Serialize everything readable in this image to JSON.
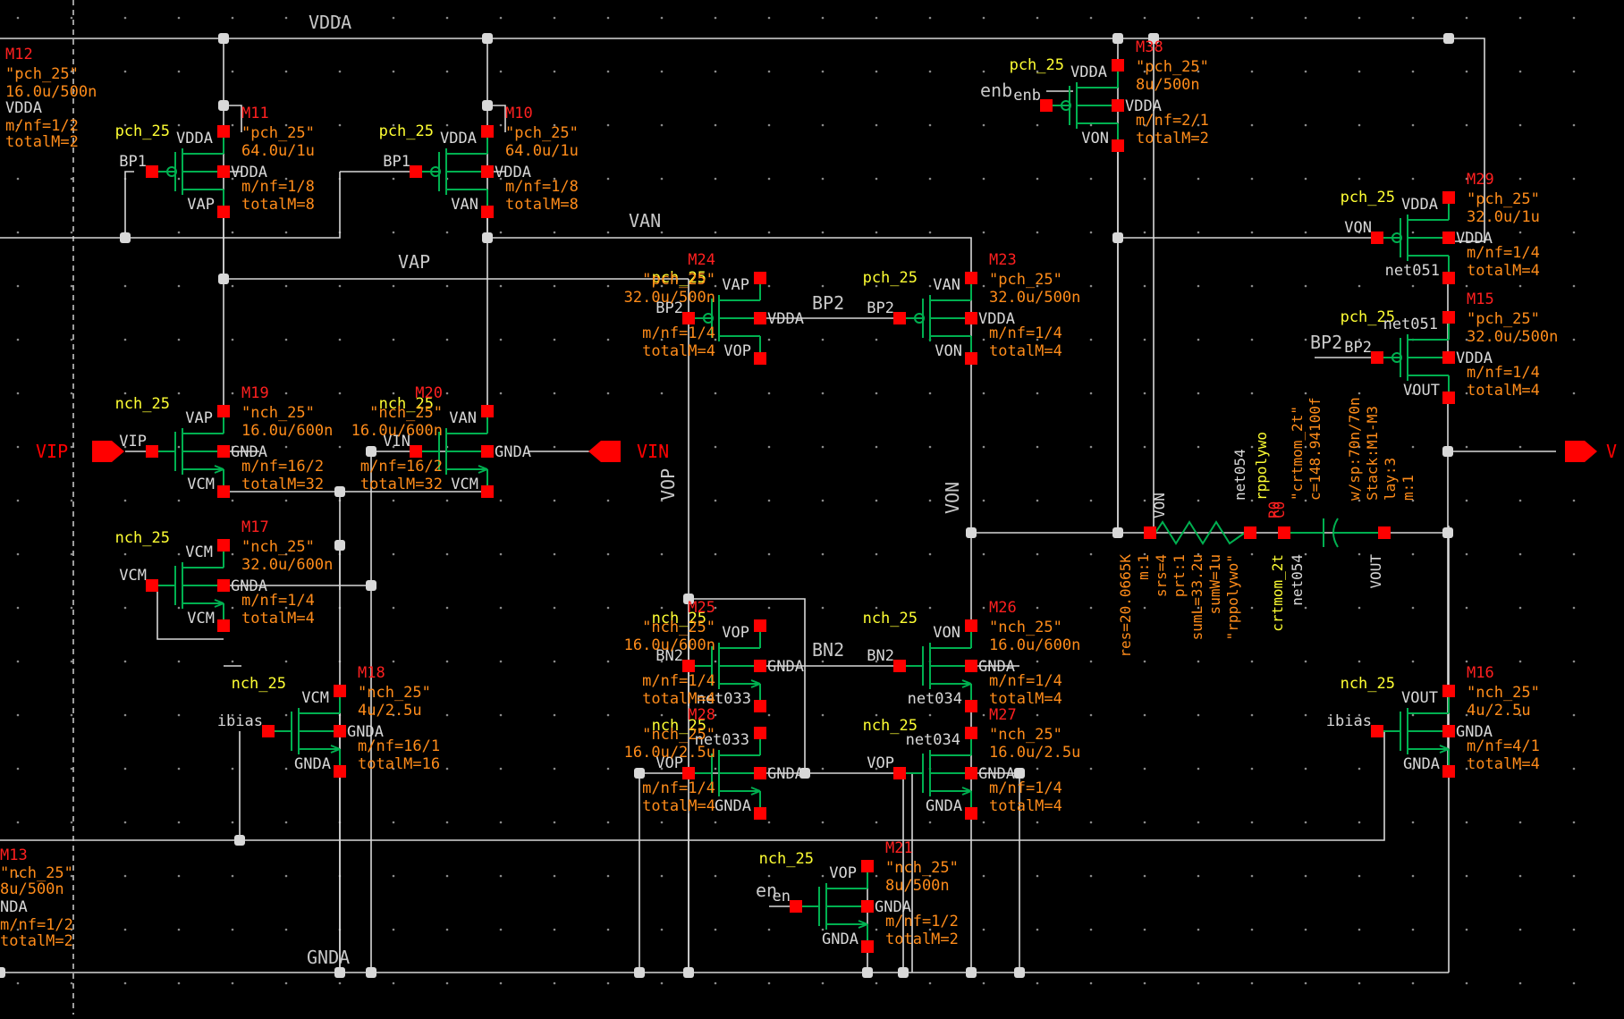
{
  "colors": {
    "background": "#000000",
    "wire": "#d8d8d8",
    "net_label": "#c8c8c8",
    "instance_name": "#ff2020",
    "cell_name": "#ffff33",
    "property": "#ff8c1a",
    "pin": "#ff0000",
    "symbol": "#00b050",
    "grid_dot": "#8a8a8a",
    "io_pin": "#ff0000"
  },
  "rails": {
    "vdd": "VDDA",
    "gnd": "GNDA"
  },
  "nets": {
    "van": "VAN",
    "vap": "VAP",
    "bp2": "BP2",
    "bn2": "BN2",
    "vop": "VOP",
    "von": "VON",
    "enb": "enb",
    "en": "en",
    "bp2_in": "BP2"
  },
  "ports": {
    "vip": "VIP",
    "vin": "VIN",
    "vout": "V"
  },
  "transistors": [
    {
      "inst": "M12",
      "cell": "",
      "model": "\"pch_25\"",
      "size": "16.0u/500n",
      "pin_b": "VDDA",
      "mnf": "m/nf=1/2",
      "total": "totalM=2"
    },
    {
      "inst": "M11",
      "cell": "pch_25",
      "model": "\"pch_25\"",
      "size": "64.0u/1u",
      "pin_g": "BP1",
      "pin_s": "VDDA",
      "pin_b": "VDDA",
      "pin_d": "VAP",
      "mnf": "m/nf=1/8",
      "total": "totalM=8"
    },
    {
      "inst": "M10",
      "cell": "pch_25",
      "model": "\"pch_25\"",
      "size": "64.0u/1u",
      "pin_g": "BP1",
      "pin_s": "VDDA",
      "pin_b": "VDDA",
      "pin_d": "VAN",
      "mnf": "m/nf=1/8",
      "total": "totalM=8"
    },
    {
      "inst": "M38",
      "cell": "pch_25",
      "model": "\"pch_25\"",
      "size": "8u/500n",
      "pin_g": "enb",
      "pin_s": "VDDA",
      "pin_b": "VDDA",
      "pin_d": "VON",
      "mnf": "m/nf=2/1",
      "total": "totalM=2"
    },
    {
      "inst": "M29",
      "cell": "pch_25",
      "model": "\"pch_25\"",
      "size": "32.0u/1u",
      "pin_g": "VON",
      "pin_s": "VDDA",
      "pin_b": "VDDA",
      "pin_d": "net051",
      "mnf": "m/nf=1/4",
      "total": "totalM=4"
    },
    {
      "inst": "M15",
      "cell": "pch_25",
      "model": "\"pch_25\"",
      "size": "32.0u/500n",
      "pin_g": "BP2",
      "pin_s": "net051",
      "pin_b": "VDDA",
      "pin_d": "VOUT",
      "mnf": "m/nf=1/4",
      "total": "totalM=4"
    },
    {
      "inst": "M24",
      "cell": "pch_25",
      "model": "\"pch_25\"",
      "size": "32.0u/500n",
      "pin_g": "BP2",
      "pin_s": "VAP",
      "pin_b": "VDDA",
      "pin_d": "VOP",
      "mnf": "m/nf=1/4",
      "total": "totalM=4"
    },
    {
      "inst": "M23",
      "cell": "pch_25",
      "model": "\"pch_25\"",
      "size": "32.0u/500n",
      "pin_g": "BP2",
      "pin_s": "VAN",
      "pin_b": "VDDA",
      "pin_d": "VON",
      "mnf": "m/nf=1/4",
      "total": "totalM=4"
    },
    {
      "inst": "M19",
      "cell": "nch_25",
      "model": "\"nch_25\"",
      "size": "16.0u/600n",
      "pin_g": "VIP",
      "pin_d": "VAP",
      "pin_b": "GNDA",
      "pin_s": "VCM",
      "mnf": "m/nf=16/2",
      "total": "totalM=32"
    },
    {
      "inst": "M20",
      "cell": "nch_25",
      "model": "\"nch_25\"",
      "size": "16.0u/600n",
      "pin_g": "VIN",
      "pin_d": "VAN",
      "pin_b": "GNDA",
      "pin_s": "VCM",
      "mnf": "m/nf=16/2",
      "total": "totalM=32"
    },
    {
      "inst": "M17",
      "cell": "nch_25",
      "model": "\"nch_25\"",
      "size": "32.0u/600n",
      "pin_g": "VCM",
      "pin_d": "VCM",
      "pin_b": "GNDA",
      "pin_s": "VCM",
      "mnf": "m/nf=1/4",
      "total": "totalM=4"
    },
    {
      "inst": "M18",
      "cell": "nch_25",
      "model": "\"nch_25\"",
      "size": "4u/2.5u",
      "pin_g": "ibias",
      "pin_d": "VCM",
      "pin_b": "GNDA",
      "pin_s": "GNDA",
      "mnf": "m/nf=16/1",
      "total": "totalM=16"
    },
    {
      "inst": "M25",
      "cell": "nch_25",
      "model": "\"nch_25\"",
      "size": "16.0u/600n",
      "pin_g": "BN2",
      "pin_d": "VOP",
      "pin_b": "GNDA",
      "pin_s": "net033",
      "mnf": "m/nf=1/4",
      "total": "totalM=4"
    },
    {
      "inst": "M26",
      "cell": "nch_25",
      "model": "\"nch_25\"",
      "size": "16.0u/600n",
      "pin_g": "BN2",
      "pin_d": "VON",
      "pin_b": "GNDA",
      "pin_s": "net034",
      "mnf": "m/nf=1/4",
      "total": "totalM=4"
    },
    {
      "inst": "M28",
      "cell": "nch_25",
      "model": "\"nch_25\"",
      "size": "16.0u/2.5u",
      "pin_g": "VOP",
      "pin_d": "net033",
      "pin_b": "GNDA",
      "pin_s": "GNDA",
      "mnf": "m/nf=1/4",
      "total": "totalM=4"
    },
    {
      "inst": "M27",
      "cell": "nch_25",
      "model": "\"nch_25\"",
      "size": "16.0u/2.5u",
      "pin_g": "VOP",
      "pin_d": "net034",
      "pin_b": "GNDA",
      "pin_s": "GNDA",
      "mnf": "m/nf=1/4",
      "total": "totalM=4"
    },
    {
      "inst": "M16",
      "cell": "nch_25",
      "model": "\"nch_25\"",
      "size": "4u/2.5u",
      "pin_g": "ibias",
      "pin_d": "VOUT",
      "pin_b": "GNDA",
      "pin_s": "GNDA",
      "mnf": "m/nf=4/1",
      "total": "totalM=4"
    },
    {
      "inst": "M21",
      "cell": "nch_25",
      "model": "\"nch_25\"",
      "size": "8u/500n",
      "pin_g": "en",
      "pin_d": "VOP",
      "pin_b": "GNDA",
      "pin_s": "GNDA",
      "mnf": "m/nf=1/2",
      "total": "totalM=2"
    },
    {
      "inst": "M13",
      "cell": "",
      "model": "\"nch_25\"",
      "size": "8u/500n",
      "pin_b": "NDA",
      "mnf": "m/nf=1/2",
      "total": "totalM=2"
    }
  ],
  "resistor": {
    "inst": "R0",
    "cell": "rppolywo",
    "pins": [
      "VON",
      "net054"
    ],
    "props": [
      "res=20.0665K",
      "m:1",
      "srs=4",
      "prt:1",
      "sumL=33.2u",
      "sumW=1u",
      "\"rppolywo\""
    ]
  },
  "capacitor": {
    "inst": "C0",
    "cell": "crtmom_2t",
    "model": "\"crtmom_2t\"",
    "value": "c=148.94100f",
    "pins": [
      "net054",
      "VOUT"
    ],
    "props": [
      "w/sp:70n/70n",
      "Stack:M1-M3",
      "lay:3",
      "m:1"
    ]
  }
}
